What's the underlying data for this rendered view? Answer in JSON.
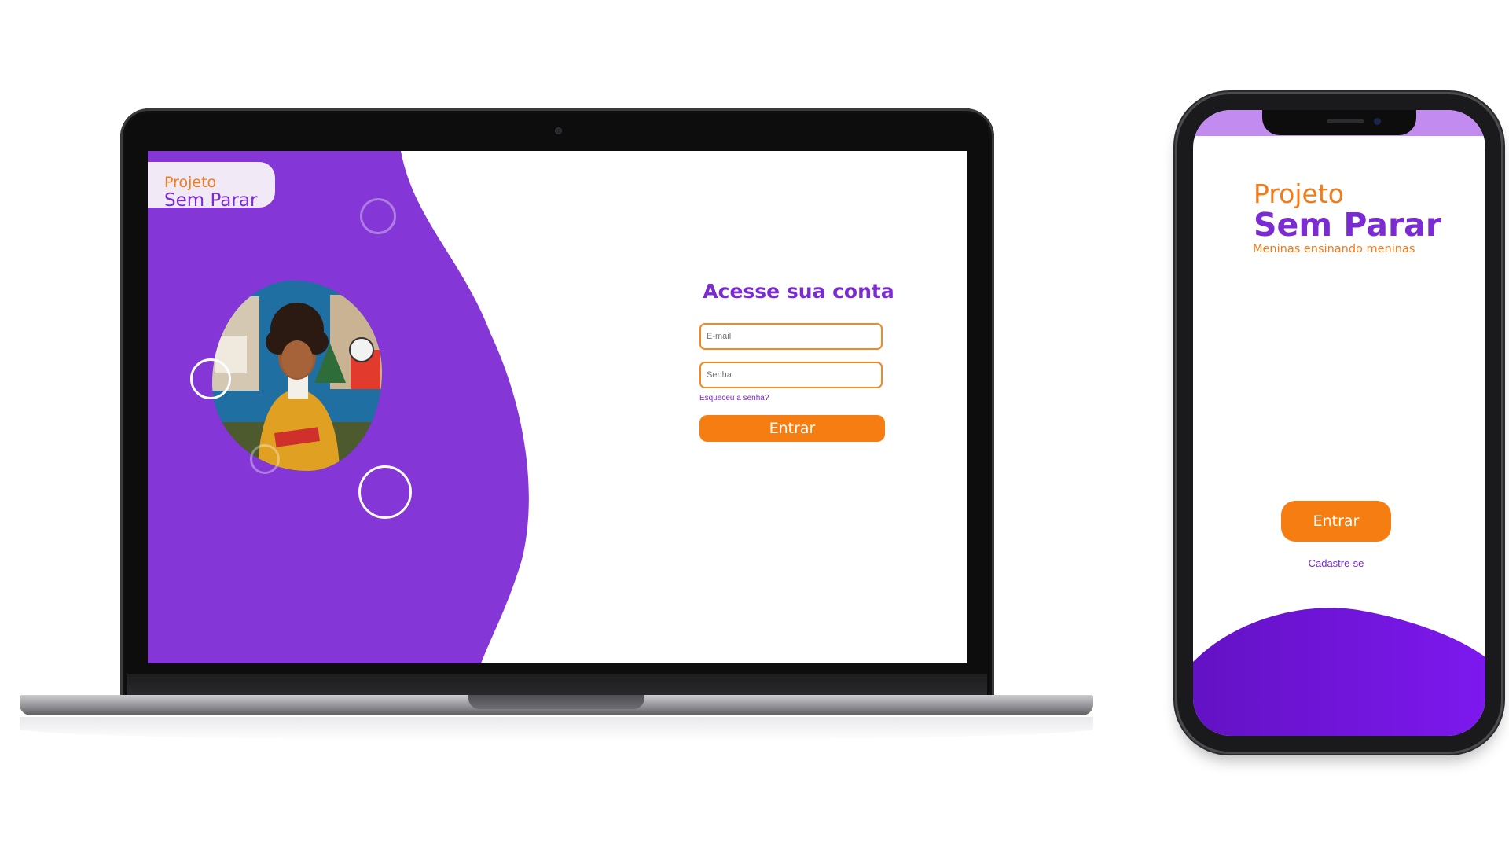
{
  "brand": {
    "line1": "Projeto",
    "line2": "Sem Parar",
    "tagline": "Meninas ensinando meninas"
  },
  "login": {
    "title": "Acesse sua conta",
    "email_placeholder": "E-mail",
    "password_placeholder": "Senha",
    "forgot_label": "Esqueceu a senha?",
    "submit_label": "Entrar"
  },
  "mobile": {
    "submit_label": "Entrar",
    "signup_label": "Cadastre-se"
  },
  "colors": {
    "purple": "#8436d6",
    "purple_text": "#7a2bd1",
    "orange": "#f57d12",
    "statusbar": "#c18bf0",
    "logo_card_bg": "#f2e9f7"
  },
  "icons": {
    "hero_photo": "woman-with-notebook-photo",
    "decor": "ring-circles"
  }
}
